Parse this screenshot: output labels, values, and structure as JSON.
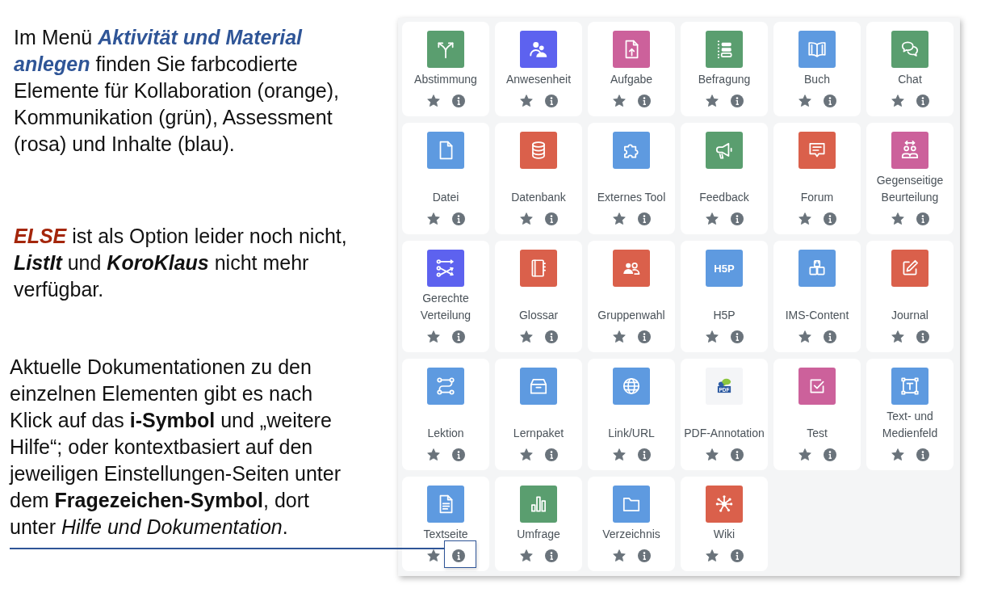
{
  "paragraphs": [
    {
      "runs": [
        {
          "text": "Im Menü ",
          "kind": "plain"
        },
        {
          "text": "Aktivität und Material anlegen",
          "kind": "bold-italic",
          "color": "#2f5597"
        },
        {
          "text": " finden Sie farbcodierte Elemente für Kollaboration (orange), Kommunikation (grün), Assessment (rosa) und Inhalte (blau).",
          "kind": "plain"
        }
      ]
    },
    {
      "runs": [
        {
          "text": "ELSE",
          "kind": "bold-italic",
          "color": "#a4260b"
        },
        {
          "text": " ist als Option leider noch nicht, ",
          "kind": "plain"
        },
        {
          "text": "ListIt",
          "kind": "bold-italic"
        },
        {
          "text": " und ",
          "kind": "plain"
        },
        {
          "text": "KoroKlaus",
          "kind": "bold-italic"
        },
        {
          "text": " nicht mehr verfügbar.",
          "kind": "plain"
        }
      ]
    },
    {
      "runs": [
        {
          "text": "Aktuelle Dokumentationen zu den einzelnen Elementen gibt es nach Klick auf das ",
          "kind": "plain"
        },
        {
          "text": "i-Symbol",
          "kind": "bold"
        },
        {
          "text": " und „weitere Hilfe“; oder kontextbasiert auf den jeweiligen Einstellungen-Seiten unter dem ",
          "kind": "plain"
        },
        {
          "text": "Fragezeichen-Symbol",
          "kind": "bold"
        },
        {
          "text": ", dort unter ",
          "kind": "plain"
        },
        {
          "text": "Hilfe und Dokumentation",
          "kind": "italic"
        },
        {
          "text": ".",
          "kind": "plain"
        }
      ]
    }
  ],
  "activity_chooser": {
    "tiles": [
      {
        "name": "Abstimmung",
        "color": "#5a9e6f",
        "info_highlighted": false
      },
      {
        "name": "Anwesenheit",
        "color": "#5d62ef",
        "info_highlighted": false
      },
      {
        "name": "Aufgabe",
        "color": "#cc619b",
        "info_highlighted": false
      },
      {
        "name": "Befragung",
        "color": "#5a9e6f",
        "info_highlighted": false
      },
      {
        "name": "Buch",
        "color": "#5e9ae0",
        "info_highlighted": false
      },
      {
        "name": "Chat",
        "color": "#5a9e6f",
        "info_highlighted": false
      },
      {
        "name": "Datei",
        "color": "#5e9ae0",
        "info_highlighted": false
      },
      {
        "name": "Datenbank",
        "color": "#da604b",
        "info_highlighted": false
      },
      {
        "name": "Externes Tool",
        "color": "#5e9ae0",
        "info_highlighted": false
      },
      {
        "name": "Feedback",
        "color": "#5a9e6f",
        "info_highlighted": false
      },
      {
        "name": "Forum",
        "color": "#da604b",
        "info_highlighted": false
      },
      {
        "name": "Gegenseitige Beurteilung",
        "color": "#cc619b",
        "info_highlighted": false
      },
      {
        "name": "Gerechte Verteilung",
        "color": "#5d62ef",
        "info_highlighted": false
      },
      {
        "name": "Glossar",
        "color": "#da604b",
        "info_highlighted": false
      },
      {
        "name": "Gruppenwahl",
        "color": "#da604b",
        "info_highlighted": false
      },
      {
        "name": "H5P",
        "color": "#5e9ae0",
        "icon_text": "H5P",
        "info_highlighted": false
      },
      {
        "name": "IMS-Content",
        "color": "#5e9ae0",
        "info_highlighted": false
      },
      {
        "name": "Journal",
        "color": "#da604b",
        "info_highlighted": false
      },
      {
        "name": "Lektion",
        "color": "#5e9ae0",
        "info_highlighted": false
      },
      {
        "name": "Lernpaket",
        "color": "#5e9ae0",
        "info_highlighted": false
      },
      {
        "name": "Link/URL",
        "color": "#5e9ae0",
        "info_highlighted": false
      },
      {
        "name": "PDF-Annotation",
        "color": "#f4f5f7",
        "icon_text": "PDF",
        "info_highlighted": false
      },
      {
        "name": "Test",
        "color": "#cc619b",
        "info_highlighted": false
      },
      {
        "name": "Text- und Medienfeld",
        "color": "#5e9ae0",
        "info_highlighted": false
      },
      {
        "name": "Textseite",
        "color": "#5e9ae0",
        "info_highlighted": true
      },
      {
        "name": "Umfrage",
        "color": "#5a9e6f",
        "info_highlighted": false
      },
      {
        "name": "Verzeichnis",
        "color": "#5e9ae0",
        "info_highlighted": false
      },
      {
        "name": "Wiki",
        "color": "#da604b",
        "info_highlighted": false
      }
    ]
  }
}
